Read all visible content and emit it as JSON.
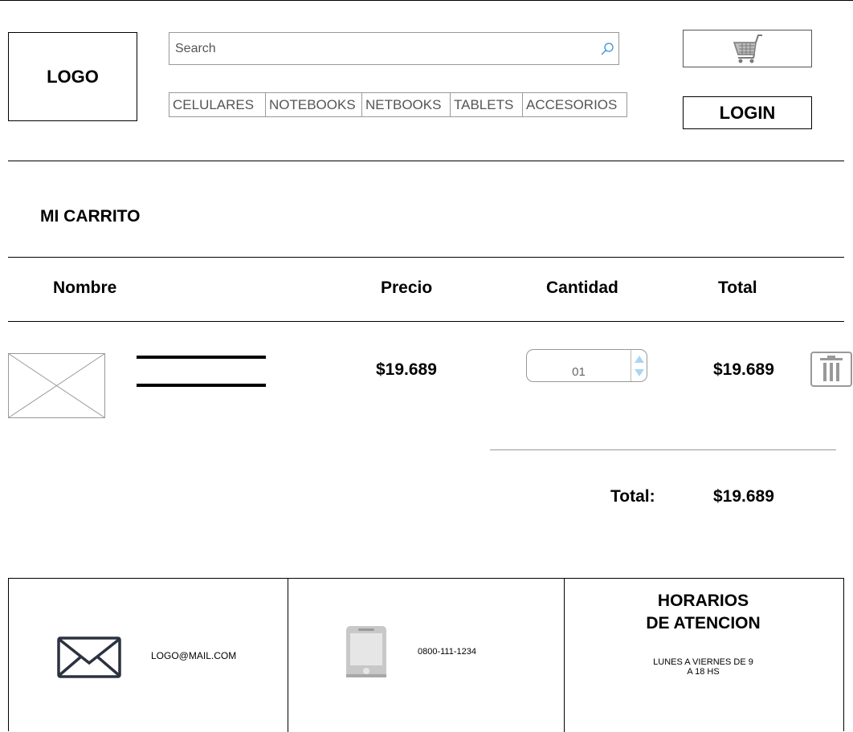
{
  "header": {
    "logo": "LOGO",
    "search": {
      "placeholder": "Search",
      "value": ""
    },
    "nav": [
      {
        "label": "CELULARES"
      },
      {
        "label": "NOTEBOOKS"
      },
      {
        "label": "NETBOOKS"
      },
      {
        "label": "TABLETS"
      },
      {
        "label": "ACCESORIOS"
      }
    ],
    "cart_icon": "shopping-cart-icon",
    "login_label": "LOGIN"
  },
  "cart": {
    "title": "MI CARRITO",
    "columns": {
      "name": "Nombre",
      "price": "Precio",
      "quantity": "Cantidad",
      "total": "Total"
    },
    "items": [
      {
        "image": "image-placeholder",
        "price": "$19.689",
        "quantity": "01",
        "total": "$19.689",
        "remove_icon": "trash-icon"
      }
    ],
    "total_label": "Total:",
    "total_value": "$19.689"
  },
  "footer": {
    "email": "LOGO@MAIL.COM",
    "email_icon": "envelope-icon",
    "phone": "0800-111-1234",
    "phone_icon": "mobile-phone-icon",
    "hours_title": "HORARIOS\nDE ATENCION",
    "hours_text": "LUNES A VIERNES DE 9\nA 18 HS"
  },
  "colors": {
    "line": "#000000",
    "muted_border": "#999999",
    "spinner_arrow": "#a9d6f2",
    "icon_gray": "#999999",
    "icon_dark": "#2b3240"
  }
}
